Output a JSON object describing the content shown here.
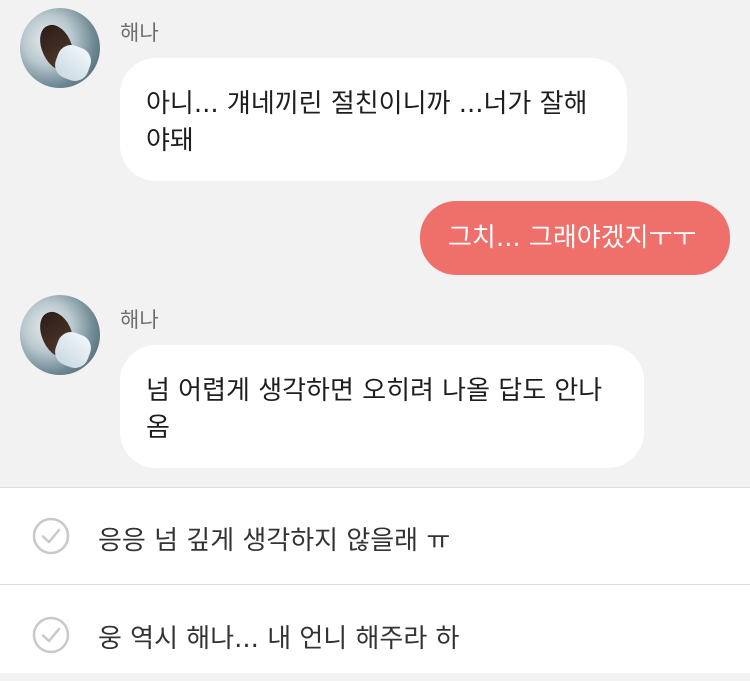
{
  "chat": {
    "messages": [
      {
        "sender": "해나",
        "text_line1": "아니... 걔네끼린 절친이니까 ...너가 잘해",
        "text_line2": "야돼"
      },
      {
        "mine": true,
        "text": "그치... 그래야겠지ㅜㅜ"
      },
      {
        "sender": "해나",
        "text_line1": "넘 어렵게 생각하면 오히려 나올 답도 안나",
        "text_line2": "옴"
      }
    ]
  },
  "options": [
    {
      "label": "응응 넘 깊게 생각하지 않을래 ㅠ",
      "icon": "check-circle-icon"
    },
    {
      "label": "웅 역시 해나... 내 언니 해주라 하",
      "icon": "check-circle-icon"
    }
  ]
}
